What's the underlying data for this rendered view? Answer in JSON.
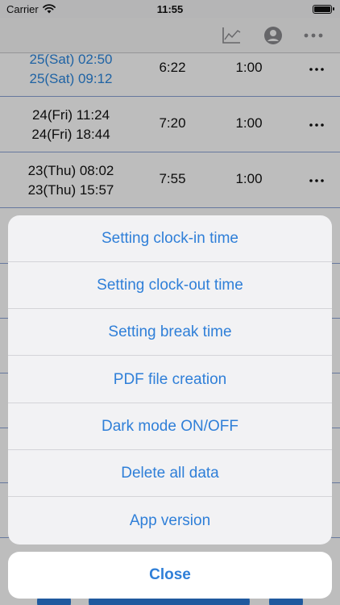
{
  "status_bar": {
    "carrier": "Carrier",
    "time": "11:55"
  },
  "nav": {
    "icons": [
      "chart-icon",
      "profile-icon",
      "more-icon"
    ]
  },
  "records": [
    {
      "clock_in": "25(Sat) 02:50",
      "clock_out": "25(Sat) 09:12",
      "work": "6:22",
      "break": "1:00",
      "highlight": true
    },
    {
      "clock_in": "24(Fri) 11:24",
      "clock_out": "24(Fri) 18:44",
      "work": "7:20",
      "break": "1:00",
      "highlight": false
    },
    {
      "clock_in": "23(Thu) 08:02",
      "clock_out": "23(Thu) 15:57",
      "work": "7:55",
      "break": "1:00",
      "highlight": false
    }
  ],
  "action_sheet": {
    "items": [
      "Setting clock-in time",
      "Setting clock-out time",
      "Setting break time",
      "PDF file creation",
      "Dark mode ON/OFF",
      "Delete all data",
      "App version"
    ],
    "close_label": "Close"
  },
  "colors": {
    "accent": "#2f7fd8",
    "highlight_text": "#2b86de",
    "row_separator": "#8aa3d6"
  }
}
